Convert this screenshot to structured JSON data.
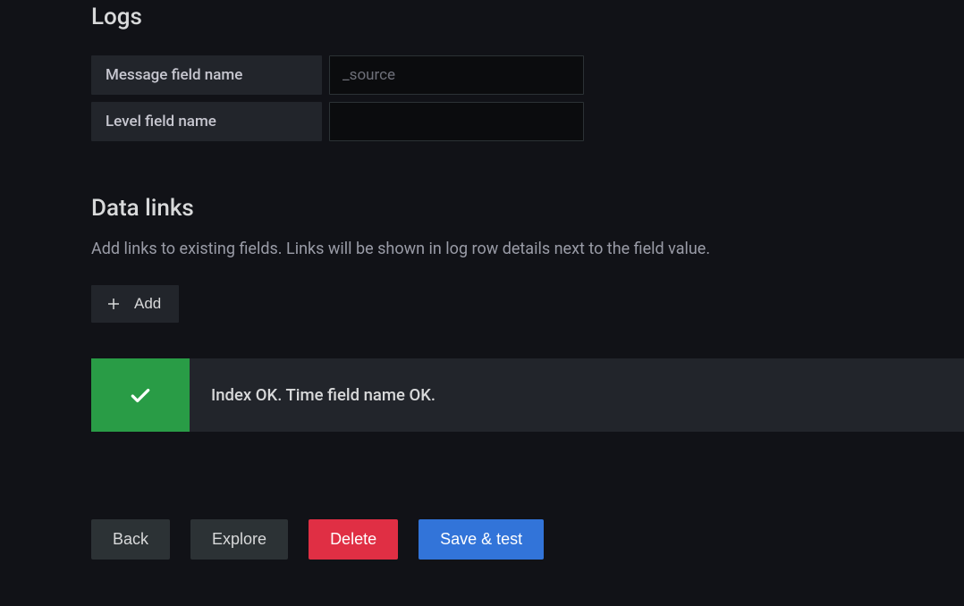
{
  "logs": {
    "title": "Logs",
    "messageFieldLabel": "Message field name",
    "messageFieldPlaceholder": "_source",
    "messageFieldValue": "",
    "levelFieldLabel": "Level field name",
    "levelFieldValue": ""
  },
  "dataLinks": {
    "title": "Data links",
    "description": "Add links to existing fields. Links will be shown in log row details next to the field value.",
    "addButtonLabel": "Add"
  },
  "alert": {
    "message": "Index OK. Time field name OK."
  },
  "buttons": {
    "back": "Back",
    "explore": "Explore",
    "delete": "Delete",
    "saveTest": "Save & test"
  }
}
